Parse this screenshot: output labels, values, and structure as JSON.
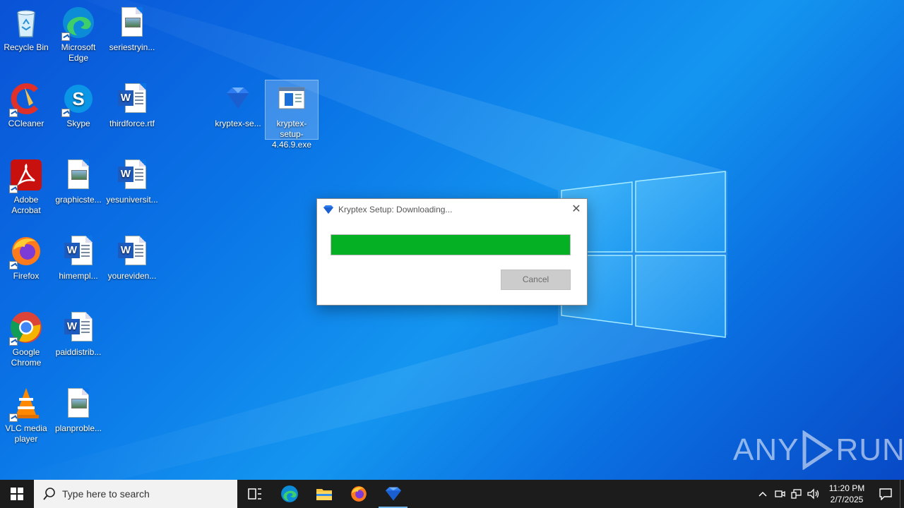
{
  "desktop": {
    "icons": [
      {
        "label": "Recycle Bin"
      },
      {
        "label": "Microsoft Edge"
      },
      {
        "label": "seriestryin..."
      },
      {
        "label": "CCleaner"
      },
      {
        "label": "Skype"
      },
      {
        "label": "thirdforce.rtf"
      },
      {
        "label": "kryptex-se..."
      },
      {
        "label": "kryptex-setup-4.46.9.exe"
      },
      {
        "label": "Adobe Acrobat"
      },
      {
        "label": "graphicste..."
      },
      {
        "label": "yesuniversit..."
      },
      {
        "label": "Firefox"
      },
      {
        "label": "himempl..."
      },
      {
        "label": "youreviden..."
      },
      {
        "label": "Google Chrome"
      },
      {
        "label": "paiddistrib..."
      },
      {
        "label": "VLC media player"
      },
      {
        "label": "planproble..."
      }
    ]
  },
  "dialog": {
    "title": "Kryptex Setup: Downloading...",
    "close_glyph": "✕",
    "progress_fraction": 1.0,
    "progress_color": "#06b025",
    "cancel_label": "Cancel"
  },
  "watermark": {
    "left": "ANY",
    "right": "RUN"
  },
  "taskbar": {
    "search_placeholder": "Type here to search",
    "apps": [
      "task-view",
      "edge",
      "file-explorer",
      "firefox",
      "kryptex"
    ],
    "clock_time": "11:20 PM",
    "clock_date": "2/7/2025"
  },
  "colors": {
    "accent": "#0078d7",
    "taskbar": "#1c1c1c",
    "wallpaper": "#0a74e6"
  }
}
